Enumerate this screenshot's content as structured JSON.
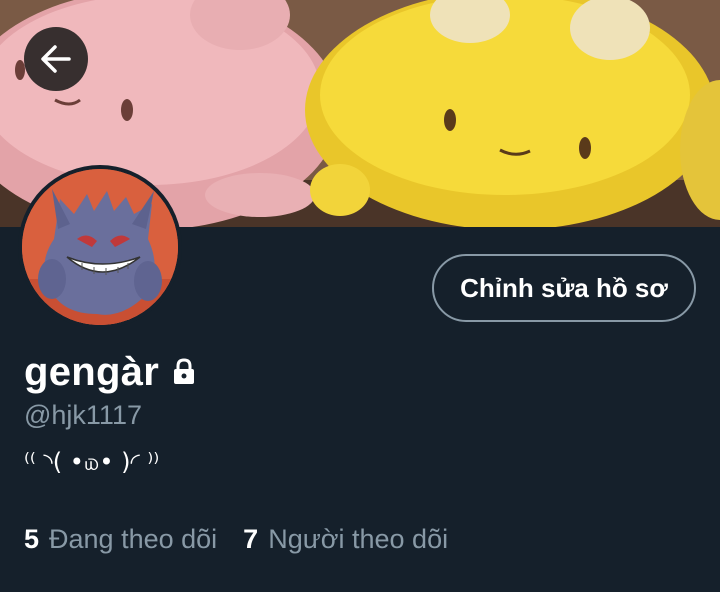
{
  "profile": {
    "display_name": "gengàr",
    "handle": "@hjk1117",
    "bio": "⁽⁽ ◝( •௰• )◜ ⁾⁾",
    "protected_icon": "lock-icon",
    "edit_profile_label": "Chỉnh sửa hồ sơ"
  },
  "stats": {
    "following_count": "5",
    "following_label": "Đang theo dõi",
    "followers_count": "7",
    "followers_label": "Người theo dõi"
  },
  "nav": {
    "back_icon": "arrow-left-icon"
  },
  "colors": {
    "background": "#15202b",
    "text_primary": "#ffffff",
    "text_secondary": "#8899a6",
    "button_border": "#8899a6"
  }
}
